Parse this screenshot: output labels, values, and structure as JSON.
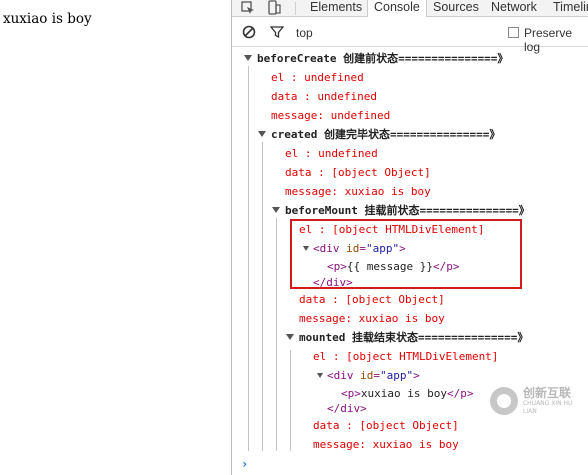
{
  "page": {
    "text": "xuxiao is boy"
  },
  "devtools": {
    "tabs": [
      "Elements",
      "Console",
      "Sources",
      "Network",
      "Timelin"
    ],
    "active_tab": "Console",
    "filter": {
      "context": "top",
      "preserve_log_label": "Preserve log"
    },
    "groups": {
      "before_create": {
        "title": "beforeCreate 创建前状态===============》",
        "lines": [
          "el     : undefined",
          "data   : undefined",
          "message: undefined"
        ]
      },
      "created": {
        "title": "created 创建完毕状态===============》",
        "lines": [
          "el     : undefined",
          "data   : [object Object]",
          "message: xuxiao is boy"
        ]
      },
      "before_mount": {
        "title": "beforeMount 挂载前状态===============》",
        "el_line": "el     : [object HTMLDivElement]",
        "dom": {
          "open_tag": "div",
          "attr": "id",
          "value": "\"app\"",
          "inner": "{{ message }}",
          "child_tag": "p"
        },
        "lines": [
          "data   : [object Object]",
          "message: xuxiao is boy"
        ]
      },
      "mounted": {
        "title": "mounted 挂载结束状态===============》",
        "el_line": "el     : [object HTMLDivElement]",
        "dom": {
          "open_tag": "div",
          "attr": "id",
          "value": "\"app\"",
          "inner": "xuxiao is boy",
          "child_tag": "p"
        },
        "lines": [
          "data   : [object Object]",
          "message: xuxiao is boy"
        ]
      }
    },
    "prompt": "›"
  },
  "watermark": {
    "cn": "创新互联",
    "en": "CHUANG XIN HU LIAN"
  },
  "colors": {
    "error_red": "#e00000",
    "highlight_box": "#d01c1c",
    "tag_purple": "#881280",
    "attr_brown": "#994500",
    "value_blue": "#1a1aa6"
  }
}
